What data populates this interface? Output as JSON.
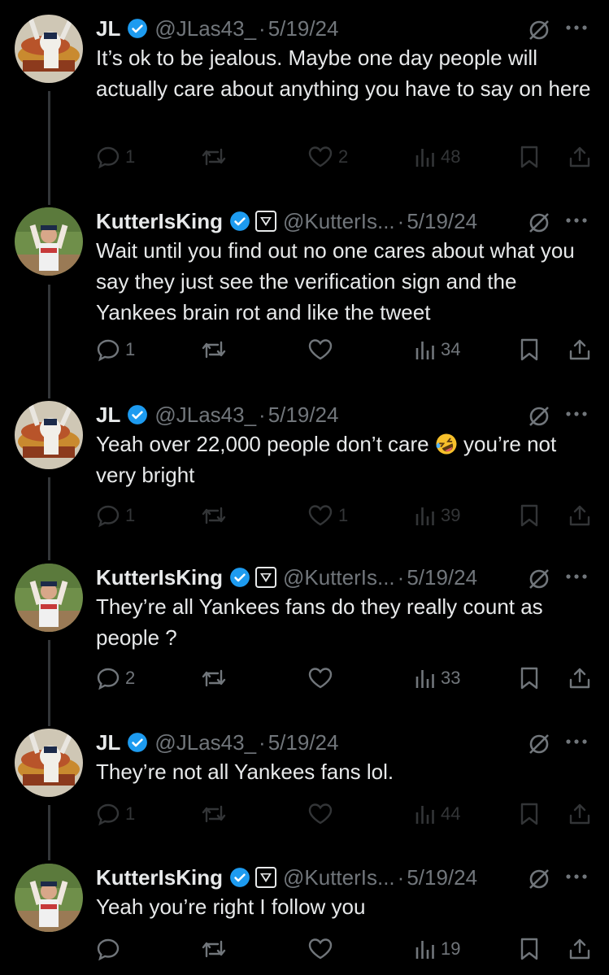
{
  "tweets": [
    {
      "name": "JL",
      "handle": "@JLas43_",
      "dot": "·",
      "date": "5/19/24",
      "affiliate": false,
      "text": "It’s ok to be jealous. Maybe one day people will actually care about anything you have to say on here",
      "replies": "1",
      "reposts": "",
      "likes": "2",
      "views": "48"
    },
    {
      "name": "KutterIsKing",
      "handle": "@KutterIs...",
      "dot": "·",
      "date": "5/19/24",
      "affiliate": true,
      "text": "Wait until you find out no one cares about what you say they just see the verification sign and the Yankees brain rot and like the tweet",
      "replies": "1",
      "reposts": "",
      "likes": "",
      "views": "34"
    },
    {
      "name": "JL",
      "handle": "@JLas43_",
      "dot": "·",
      "date": "5/19/24",
      "affiliate": false,
      "text_before": "Yeah over 22,000 people don’t care ",
      "text_after": " you’re not very bright",
      "emoji": "rolling-on-floor-laughing",
      "replies": "1",
      "reposts": "",
      "likes": "1",
      "views": "39"
    },
    {
      "name": "KutterIsKing",
      "handle": "@KutterIs...",
      "dot": "·",
      "date": "5/19/24",
      "affiliate": true,
      "text": "They’re all Yankees fans do they really count as people ?",
      "replies": "2",
      "reposts": "",
      "likes": "",
      "views": "33"
    },
    {
      "name": "JL",
      "handle": "@JLas43_",
      "dot": "·",
      "date": "5/19/24",
      "affiliate": false,
      "text": "They’re not all Yankees fans lol.",
      "replies": "1",
      "reposts": "",
      "likes": "",
      "views": "44"
    },
    {
      "name": "KutterIsKing",
      "handle": "@KutterIs...",
      "dot": "·",
      "date": "5/19/24",
      "affiliate": true,
      "text": "Yeah you’re right I follow you",
      "replies": "",
      "reposts": "",
      "likes": "",
      "views": "19"
    }
  ],
  "icons": {
    "reply": "reply-icon",
    "repost": "repost-icon",
    "like": "like-icon",
    "views": "views-icon",
    "bookmark": "bookmark-icon",
    "share": "share-icon",
    "grok": "grok-icon",
    "more": "more-icon",
    "verified": "verified-badge-icon",
    "affiliate": "affiliate-badge-icon"
  },
  "colors": {
    "background": "#000000",
    "text": "#e7e9ea",
    "secondary": "#71767b",
    "verified": "#1d9bf0"
  }
}
